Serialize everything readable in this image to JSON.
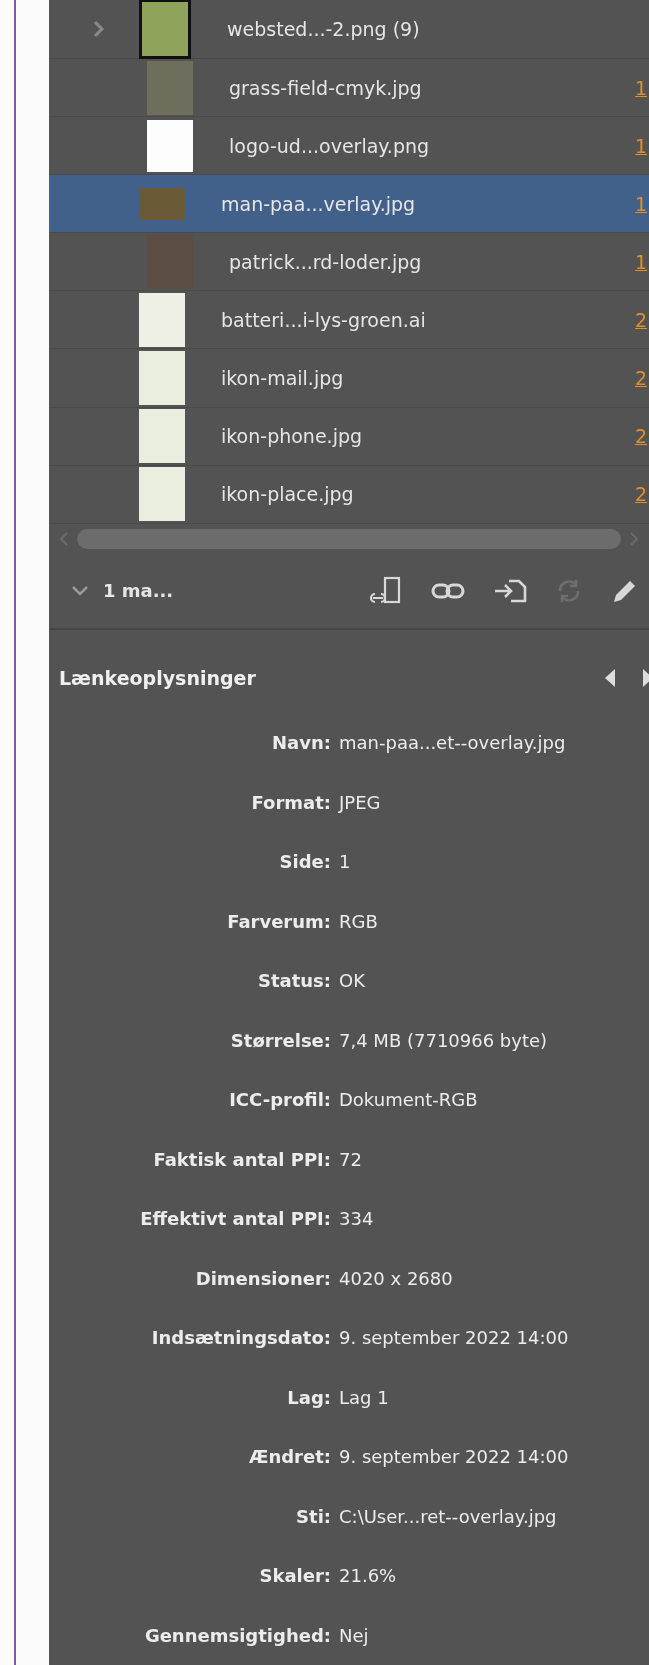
{
  "links": [
    {
      "kind": "group",
      "name": "websted...-2.png (9)",
      "expanded": false,
      "selected": false
    },
    {
      "kind": "file",
      "name": "grass-field-cmyk.jpg",
      "page": "1",
      "selected": false
    },
    {
      "kind": "file",
      "name": "logo-ud...overlay.png",
      "page": "1",
      "selected": false
    },
    {
      "kind": "file",
      "name": "man-paa...verlay.jpg",
      "page": "1",
      "selected": true
    },
    {
      "kind": "file",
      "name": "patrick...rd-loder.jpg",
      "page": "1",
      "selected": false
    },
    {
      "kind": "file",
      "name": "batteri...i-lys-groen.ai",
      "page": "2",
      "selected": false
    },
    {
      "kind": "file",
      "name": "ikon-mail.jpg",
      "page": "2",
      "selected": false
    },
    {
      "kind": "file",
      "name": "ikon-phone.jpg",
      "page": "2",
      "selected": false
    },
    {
      "kind": "file",
      "name": "ikon-place.jpg",
      "page": "2",
      "selected": false
    }
  ],
  "toolbar": {
    "label": "1 ma...",
    "expanded": true,
    "buttons": [
      {
        "kind": "relink-cc",
        "disabled": false
      },
      {
        "kind": "relink",
        "disabled": false
      },
      {
        "kind": "goto",
        "disabled": false
      },
      {
        "kind": "update",
        "disabled": true
      },
      {
        "kind": "edit",
        "disabled": false
      }
    ]
  },
  "info": {
    "title": "Lænkeoplysninger",
    "fields": [
      {
        "label": "Navn:",
        "value": "man-paa...et--overlay.jpg"
      },
      {
        "label": "Format:",
        "value": "JPEG"
      },
      {
        "label": "Side:",
        "value": "1"
      },
      {
        "label": "Farverum:",
        "value": "RGB"
      },
      {
        "label": "Status:",
        "value": "OK"
      },
      {
        "label": "Størrelse:",
        "value": "7,4 MB (7710966 byte)"
      },
      {
        "label": "ICC-profil:",
        "value": "Dokument-RGB"
      },
      {
        "label": "Faktisk antal PPI:",
        "value": "72"
      },
      {
        "label": "Effektivt antal PPI:",
        "value": "334"
      },
      {
        "label": "Dimensioner:",
        "value": "4020 x 2680"
      },
      {
        "label": "Indsætningsdato:",
        "value": "9. september 2022 14:00"
      },
      {
        "label": "Lag:",
        "value": "Lag 1"
      },
      {
        "label": "Ændret:",
        "value": "9. september 2022 14:00"
      },
      {
        "label": "Sti:",
        "value": "C:\\User...ret--overlay.jpg"
      },
      {
        "label": "Skaler:",
        "value": "21.6%"
      },
      {
        "label": "Gennemsigtighed:",
        "value": "Nej"
      }
    ]
  }
}
